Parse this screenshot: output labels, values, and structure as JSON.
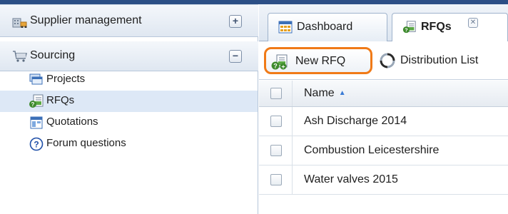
{
  "sidebar": {
    "sections": [
      {
        "label": "Supplier management",
        "toggle": "+",
        "icon": "building-truck-icon",
        "expanded": false
      },
      {
        "label": "Sourcing",
        "toggle": "−",
        "icon": "shopping-cart-icon",
        "expanded": true
      }
    ],
    "items": [
      {
        "label": "Projects",
        "icon": "projects-icon",
        "active": false
      },
      {
        "label": "RFQs",
        "icon": "rfq-document-icon",
        "active": true
      },
      {
        "label": "Quotations",
        "icon": "quotations-icon",
        "active": false
      },
      {
        "label": "Forum questions",
        "icon": "question-circle-icon",
        "active": false
      }
    ]
  },
  "tabs": [
    {
      "label": "Dashboard",
      "icon": "dashboard-icon",
      "active": false
    },
    {
      "label": "RFQs",
      "icon": "rfq-document-icon",
      "active": true,
      "close": "✕"
    }
  ],
  "toolbar": {
    "new_rfq_label": "New RFQ",
    "distribution_label": "Distribution List"
  },
  "grid": {
    "columns": [
      {
        "label": "Name",
        "sort": "ascending"
      }
    ],
    "rows": [
      {
        "name": "Ash Discharge 2014"
      },
      {
        "name": "Combustion Leicestershire"
      },
      {
        "name": "Water valves 2015"
      }
    ]
  },
  "colors": {
    "highlight_border": "#f07a17",
    "active_row": "#dde8f6",
    "top_bar": "#2c4f86"
  }
}
